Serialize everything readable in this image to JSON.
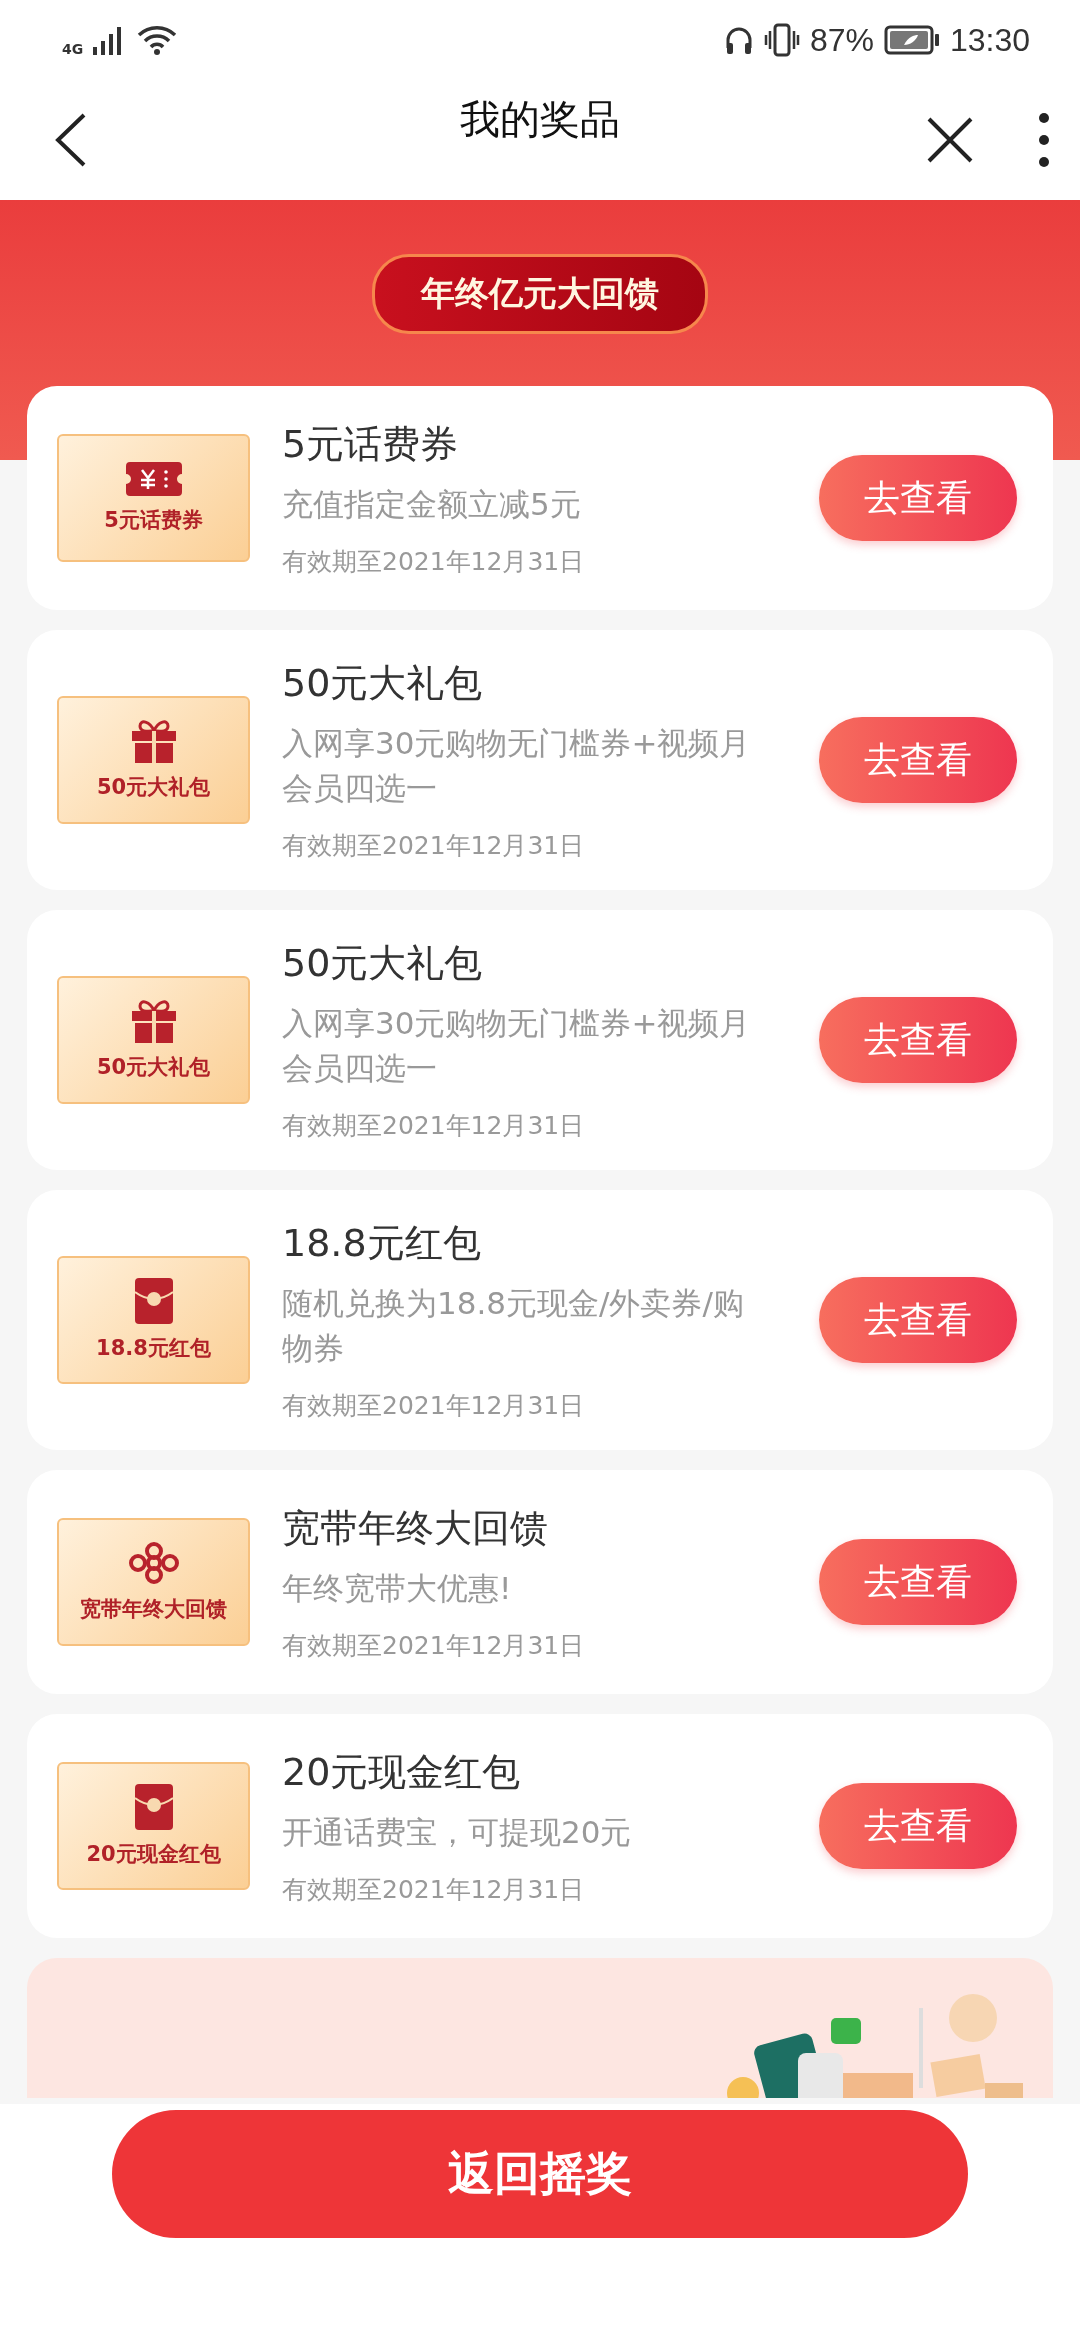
{
  "status_bar": {
    "network": "4G",
    "battery": "87%",
    "time": "13:30"
  },
  "nav": {
    "title": "我的奖品"
  },
  "banner": {
    "badge": "年终亿元大回馈"
  },
  "prizes": [
    {
      "kind": "coupon",
      "thumb_label": "5元话费券",
      "title": "5元话费券",
      "description": "充值指定金额立减5元",
      "validity": "有效期至2021年12月31日",
      "action": "去查看"
    },
    {
      "kind": "gift",
      "thumb_label": "50元大礼包",
      "title": "50元大礼包",
      "description": "入网享30元购物无门槛券+视频月会员四选一",
      "validity": "有效期至2021年12月31日",
      "action": "去查看"
    },
    {
      "kind": "gift",
      "thumb_label": "50元大礼包",
      "title": "50元大礼包",
      "description": "入网享30元购物无门槛券+视频月会员四选一",
      "validity": "有效期至2021年12月31日",
      "action": "去查看"
    },
    {
      "kind": "envelope",
      "thumb_label": "18.8元红包",
      "title": "18.8元红包",
      "description": "随机兑换为18.8元现金/外卖券/购物券",
      "validity": "有效期至2021年12月31日",
      "action": "去查看"
    },
    {
      "kind": "knot",
      "thumb_label": "宽带年终大回馈",
      "title": "宽带年终大回馈",
      "description": "年终宽带大优惠!",
      "validity": "有效期至2021年12月31日",
      "action": "去查看"
    },
    {
      "kind": "envelope",
      "thumb_label": "20元现金红包",
      "title": "20元现金红包",
      "description": "开通话费宝，可提现20元",
      "validity": "有效期至2021年12月31日",
      "action": "去查看"
    }
  ],
  "bottom_button": "返回摇奖"
}
